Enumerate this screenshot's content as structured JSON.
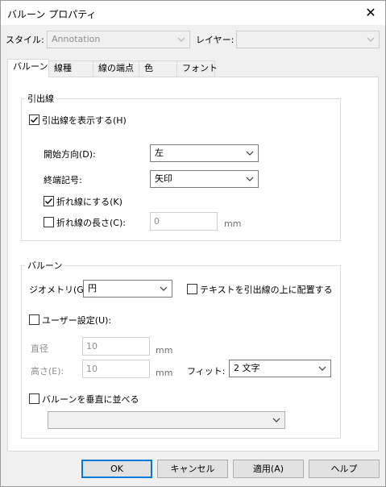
{
  "window": {
    "title": "バルーン プロパティ",
    "close_glyph": "✕"
  },
  "top": {
    "style_label": "スタイル:",
    "style_value": "Annotation",
    "layer_label": "レイヤー:",
    "layer_value": ""
  },
  "tabs": [
    {
      "label": "バルーン",
      "active": true
    },
    {
      "label": "線種",
      "active": false
    },
    {
      "label": "線の端点",
      "active": false
    },
    {
      "label": "色",
      "active": false
    },
    {
      "label": "フォント",
      "active": false
    }
  ],
  "leader": {
    "group_title": "引出線",
    "show_leader": {
      "label": "引出線を表示する(H)",
      "checked": true
    },
    "start_direction": {
      "label": "開始方向(D):",
      "value": "左"
    },
    "end_symbol": {
      "label": "終端記号:",
      "value": "矢印"
    },
    "polyline": {
      "label": "折れ線にする(K)",
      "checked": true
    },
    "polyline_length": {
      "label": "折れ線の長さ(C):",
      "checked": false,
      "value": "0",
      "unit": "mm"
    }
  },
  "balloon": {
    "group_title": "バルーン",
    "geometry": {
      "label": "ジオメトリ(G):",
      "value": "円"
    },
    "text_above": {
      "label": "テキストを引出線の上に配置する",
      "checked": false
    },
    "user_defined": {
      "label": "ユーザー設定(U):",
      "checked": false
    },
    "diameter": {
      "label": "直径",
      "value": "10",
      "unit": "mm"
    },
    "height": {
      "label": "高さ(E):",
      "value": "10",
      "unit": "mm"
    },
    "fit": {
      "label": "フィット:",
      "value": "2 文字"
    },
    "stack_vertical": {
      "label": "バルーンを垂直に並べる",
      "checked": false
    },
    "stack_value": ""
  },
  "buttons": {
    "ok": "OK",
    "cancel": "キャンセル",
    "apply": "適用(A)",
    "help": "ヘルプ"
  }
}
